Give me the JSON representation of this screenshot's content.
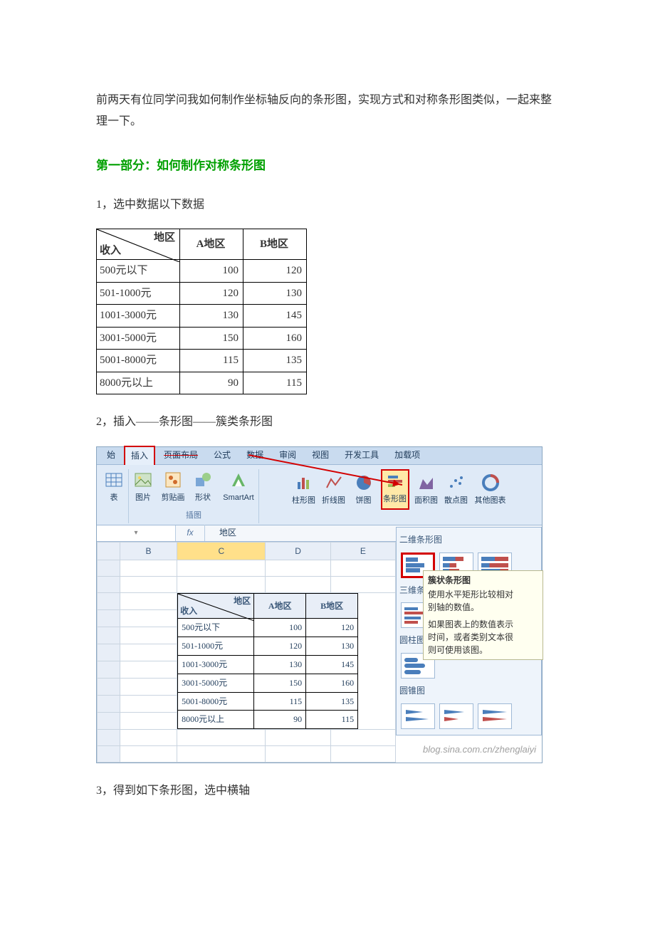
{
  "intro": "前两天有位同学问我如何制作坐标轴反向的条形图，实现方式和对称条形图类似，一起来整理一下。",
  "section1_title": "第一部分：如何制作对称条形图",
  "step1": "1，选中数据以下数据",
  "step2": "2，插入——条形图——簇类条形图",
  "step3": "3，得到如下条形图，选中横轴",
  "table": {
    "diag_top": "地区",
    "diag_bot": "收入",
    "col1": "A地区",
    "col2": "B地区",
    "rows": [
      {
        "label": "500元以下",
        "a": "100",
        "b": "120"
      },
      {
        "label": "501-1000元",
        "a": "120",
        "b": "130"
      },
      {
        "label": "1001-3000元",
        "a": "130",
        "b": "145"
      },
      {
        "label": "3001-5000元",
        "a": "150",
        "b": "160"
      },
      {
        "label": "5001-8000元",
        "a": "115",
        "b": "135"
      },
      {
        "label": "8000元以上",
        "a": "90",
        "b": "115"
      }
    ]
  },
  "chart_data": {
    "type": "bar",
    "categories": [
      "500元以下",
      "501-1000元",
      "1001-3000元",
      "3001-5000元",
      "5001-8000元",
      "8000元以上"
    ],
    "series": [
      {
        "name": "A地区",
        "values": [
          100,
          120,
          130,
          150,
          115,
          90
        ]
      },
      {
        "name": "B地区",
        "values": [
          120,
          130,
          145,
          160,
          135,
          115
        ]
      }
    ],
    "title": "",
    "xlabel": "收入",
    "ylabel": ""
  },
  "excel": {
    "tab_start_partial": "始",
    "tabs": [
      "插入",
      "页面布局",
      "公式",
      "数据",
      "审阅",
      "视图",
      "开发工具",
      "加载项"
    ],
    "table_label": "表",
    "icons_illustrations": [
      "图片",
      "剪贴画",
      "形状",
      "SmartArt"
    ],
    "group_illustrations": "插图",
    "icons_charts": [
      "柱形图",
      "折线图",
      "饼图",
      "条形图",
      "面积图",
      "散点图",
      "其他图表"
    ],
    "namebox": "",
    "fx": "fx",
    "formula_value": "地区",
    "columns": [
      "",
      "B",
      "C",
      "D",
      "E"
    ],
    "dropdown": {
      "sec1": "二维条形图",
      "sec2": "三维条",
      "sec3": "圆柱图",
      "sec4": "圆锥图",
      "tip_title": "簇状条形图",
      "tip_line1": "使用水平矩形比较相对",
      "tip_line2": "别轴的数值。",
      "tip_line3": "如果图表上的数值表示",
      "tip_line4": "时间，或者类别文本很",
      "tip_line5": "则可使用该图。"
    },
    "watermark": "blog.sina.com.cn/zhenglaiyi"
  }
}
